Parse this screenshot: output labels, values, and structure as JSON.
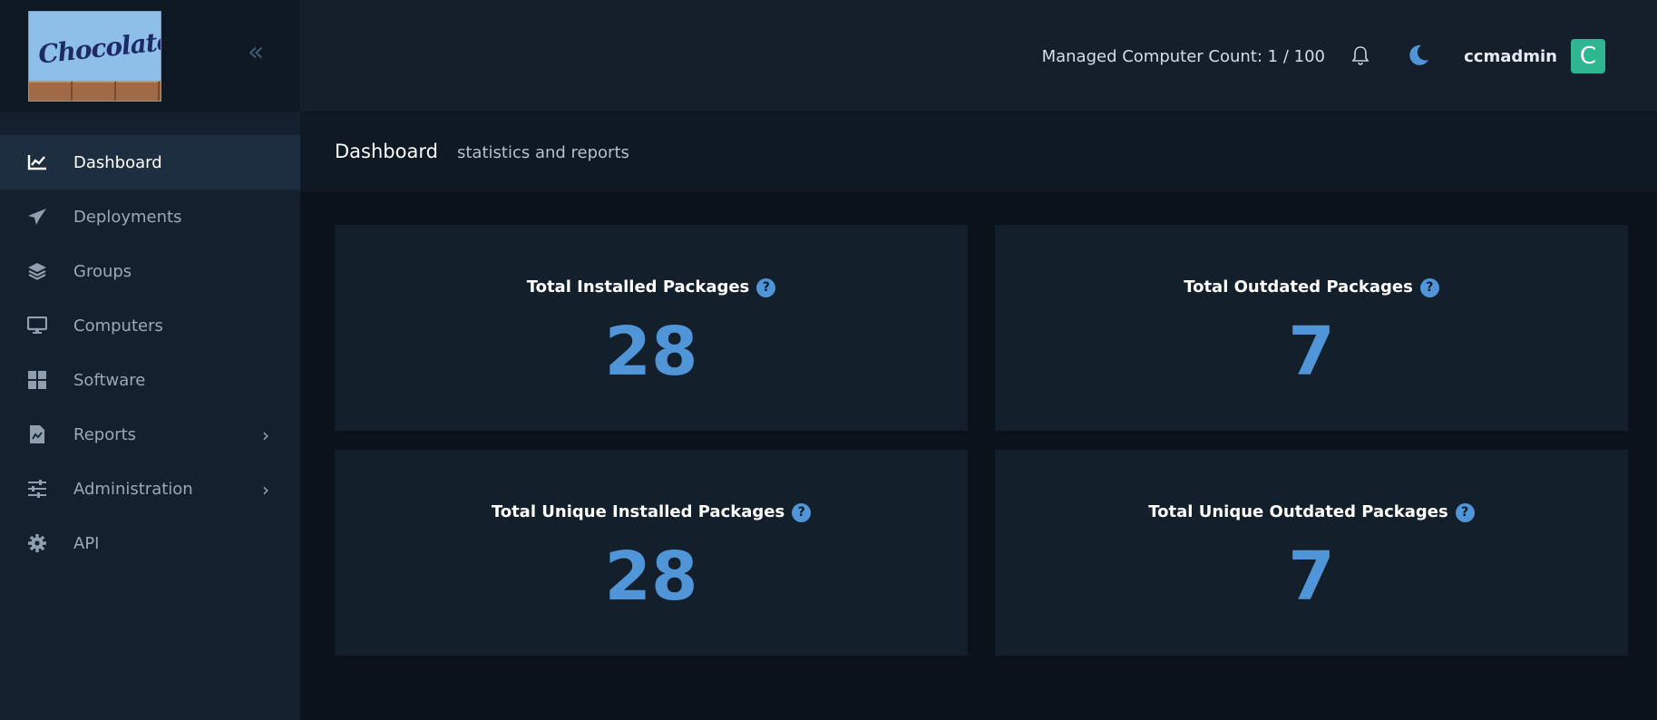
{
  "brand": {
    "logo_text": "Chocolatey"
  },
  "sidebar": {
    "collapse_icon": "double-chevron-left-icon",
    "items": [
      {
        "label": "Dashboard",
        "icon": "chart-icon",
        "active": true
      },
      {
        "label": "Deployments",
        "icon": "paper-plane-icon"
      },
      {
        "label": "Groups",
        "icon": "layers-icon"
      },
      {
        "label": "Computers",
        "icon": "monitor-icon"
      },
      {
        "label": "Software",
        "icon": "windows-icon"
      },
      {
        "label": "Reports",
        "icon": "report-icon",
        "expandable": true
      },
      {
        "label": "Administration",
        "icon": "sliders-icon",
        "expandable": true
      },
      {
        "label": "API",
        "icon": "gear-icon"
      }
    ]
  },
  "topbar": {
    "managed_count": "Managed Computer Count: 1 / 100",
    "username": "ccmadmin",
    "avatar_letter": "C"
  },
  "header": {
    "title": "Dashboard",
    "subtitle": "statistics and reports"
  },
  "cards": [
    {
      "title": "Total Installed Packages",
      "value": "28"
    },
    {
      "title": "Total Outdated Packages",
      "value": "7"
    },
    {
      "title": "Total Unique Installed Packages",
      "value": "28"
    },
    {
      "title": "Total Unique Outdated Packages",
      "value": "7"
    }
  ],
  "colors": {
    "accent": "#4f95d8",
    "avatar": "#2fb58f",
    "sidebar_bg": "#14202d",
    "content_bg": "#0b121b"
  }
}
